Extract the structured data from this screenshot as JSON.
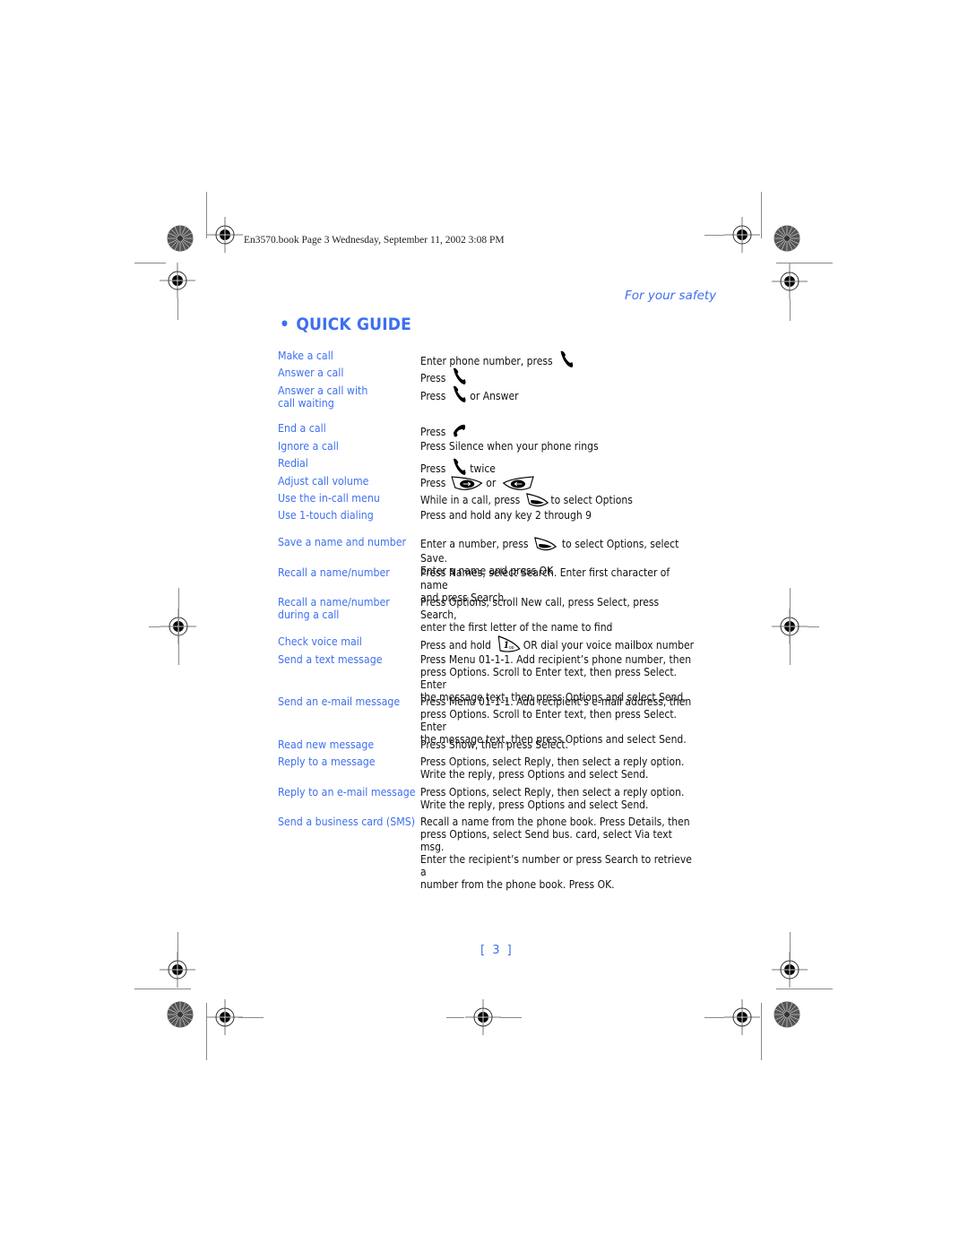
{
  "print_header": "En3570.book  Page 3  Wednesday, September 11, 2002  3:08 PM",
  "section_name": "For your safety",
  "title": "QUICK GUIDE",
  "title_bullet": "•",
  "colors": {
    "accent": "#3e6ff0",
    "text": "#111111",
    "marks": "#8a8a8a"
  },
  "rows": [
    {
      "label": "Make a call",
      "parts": [
        "Enter phone number, press",
        "[send-key-icon]"
      ]
    },
    {
      "label": "Answer a call",
      "parts": [
        "Press",
        "[send-key-icon]"
      ]
    },
    {
      "label": "Answer a call with call waiting",
      "label_lines": [
        "Answer a call with",
        "call waiting"
      ],
      "parts": [
        "Press",
        "[send-key-icon]",
        "or Answer"
      ]
    },
    {
      "label": "End a call",
      "parts": [
        "Press",
        "[end-key-icon]"
      ]
    },
    {
      "label": "Ignore a call",
      "parts": [
        "Press",
        "Silence",
        "when your phone rings"
      ]
    },
    {
      "label": "Redial",
      "parts": [
        "Press",
        "[send-key-icon]",
        "twice"
      ]
    },
    {
      "label": "Adjust call volume",
      "parts": [
        "Press",
        "[volume-up-key-icon]",
        "or",
        "[volume-down-key-icon]"
      ]
    },
    {
      "label": "Use the in-call menu",
      "parts": [
        "While in a call, press",
        "[selection-key-icon]",
        "to select Options"
      ]
    },
    {
      "label": "Use 1-touch dialing",
      "parts": [
        "Press and hold any key 2 through 9"
      ]
    },
    {
      "label": "Save a name and number",
      "lines": [
        "Enter a number, press [selection-key-icon] to select Options, select Save.",
        "Enter a name and press OK"
      ]
    },
    {
      "label": "Recall a name/number",
      "lines": [
        "Press Names, select Search. Enter first character of name",
        "and press Search"
      ]
    },
    {
      "label": "Recall a name/number during a call",
      "label_lines": [
        "Recall a name/number",
        "during a call"
      ],
      "lines": [
        "Press Options, scroll New call, press Select, press Search,",
        "enter the first letter of the name to find"
      ]
    },
    {
      "label": "Check voice mail",
      "parts": [
        "Press and hold",
        "[key-1-voicemail-icon]",
        "OR dial your voice mailbox number"
      ]
    },
    {
      "label": "Send a text message",
      "lines": [
        "Press Menu 01-1-1. Add recipient’s phone number, then",
        "press Options. Scroll to Enter text, then press Select. Enter",
        "the message text, then press Options and select Send."
      ]
    },
    {
      "label": "Send an e-mail message",
      "lines": [
        "Press Menu 01-1-1. Add recipient’s e-mail address, then",
        "press Options. Scroll to Enter text, then press Select. Enter",
        "the message text, then press Options and select Send."
      ]
    },
    {
      "label": "Read new message",
      "lines": [
        "Press Show, then press Select."
      ]
    },
    {
      "label": "Reply to a message",
      "lines": [
        "Press Options, select Reply, then select a reply option.",
        "Write the reply, press Options and select Send."
      ]
    },
    {
      "label": "Reply to an e-mail message",
      "lines": [
        "Press Options, select Reply, then select a reply option.",
        "Write the reply, press Options and select Send."
      ]
    },
    {
      "label": "Send a business card (SMS)",
      "lines": [
        "Recall a name from the phone book. Press Details, then",
        "press Options, select Send bus. card, select Via text msg.",
        "Enter the recipient’s number or press Search to retrieve a",
        "number from the phone book. Press OK."
      ]
    }
  ],
  "page_number": "[ 3 ]"
}
